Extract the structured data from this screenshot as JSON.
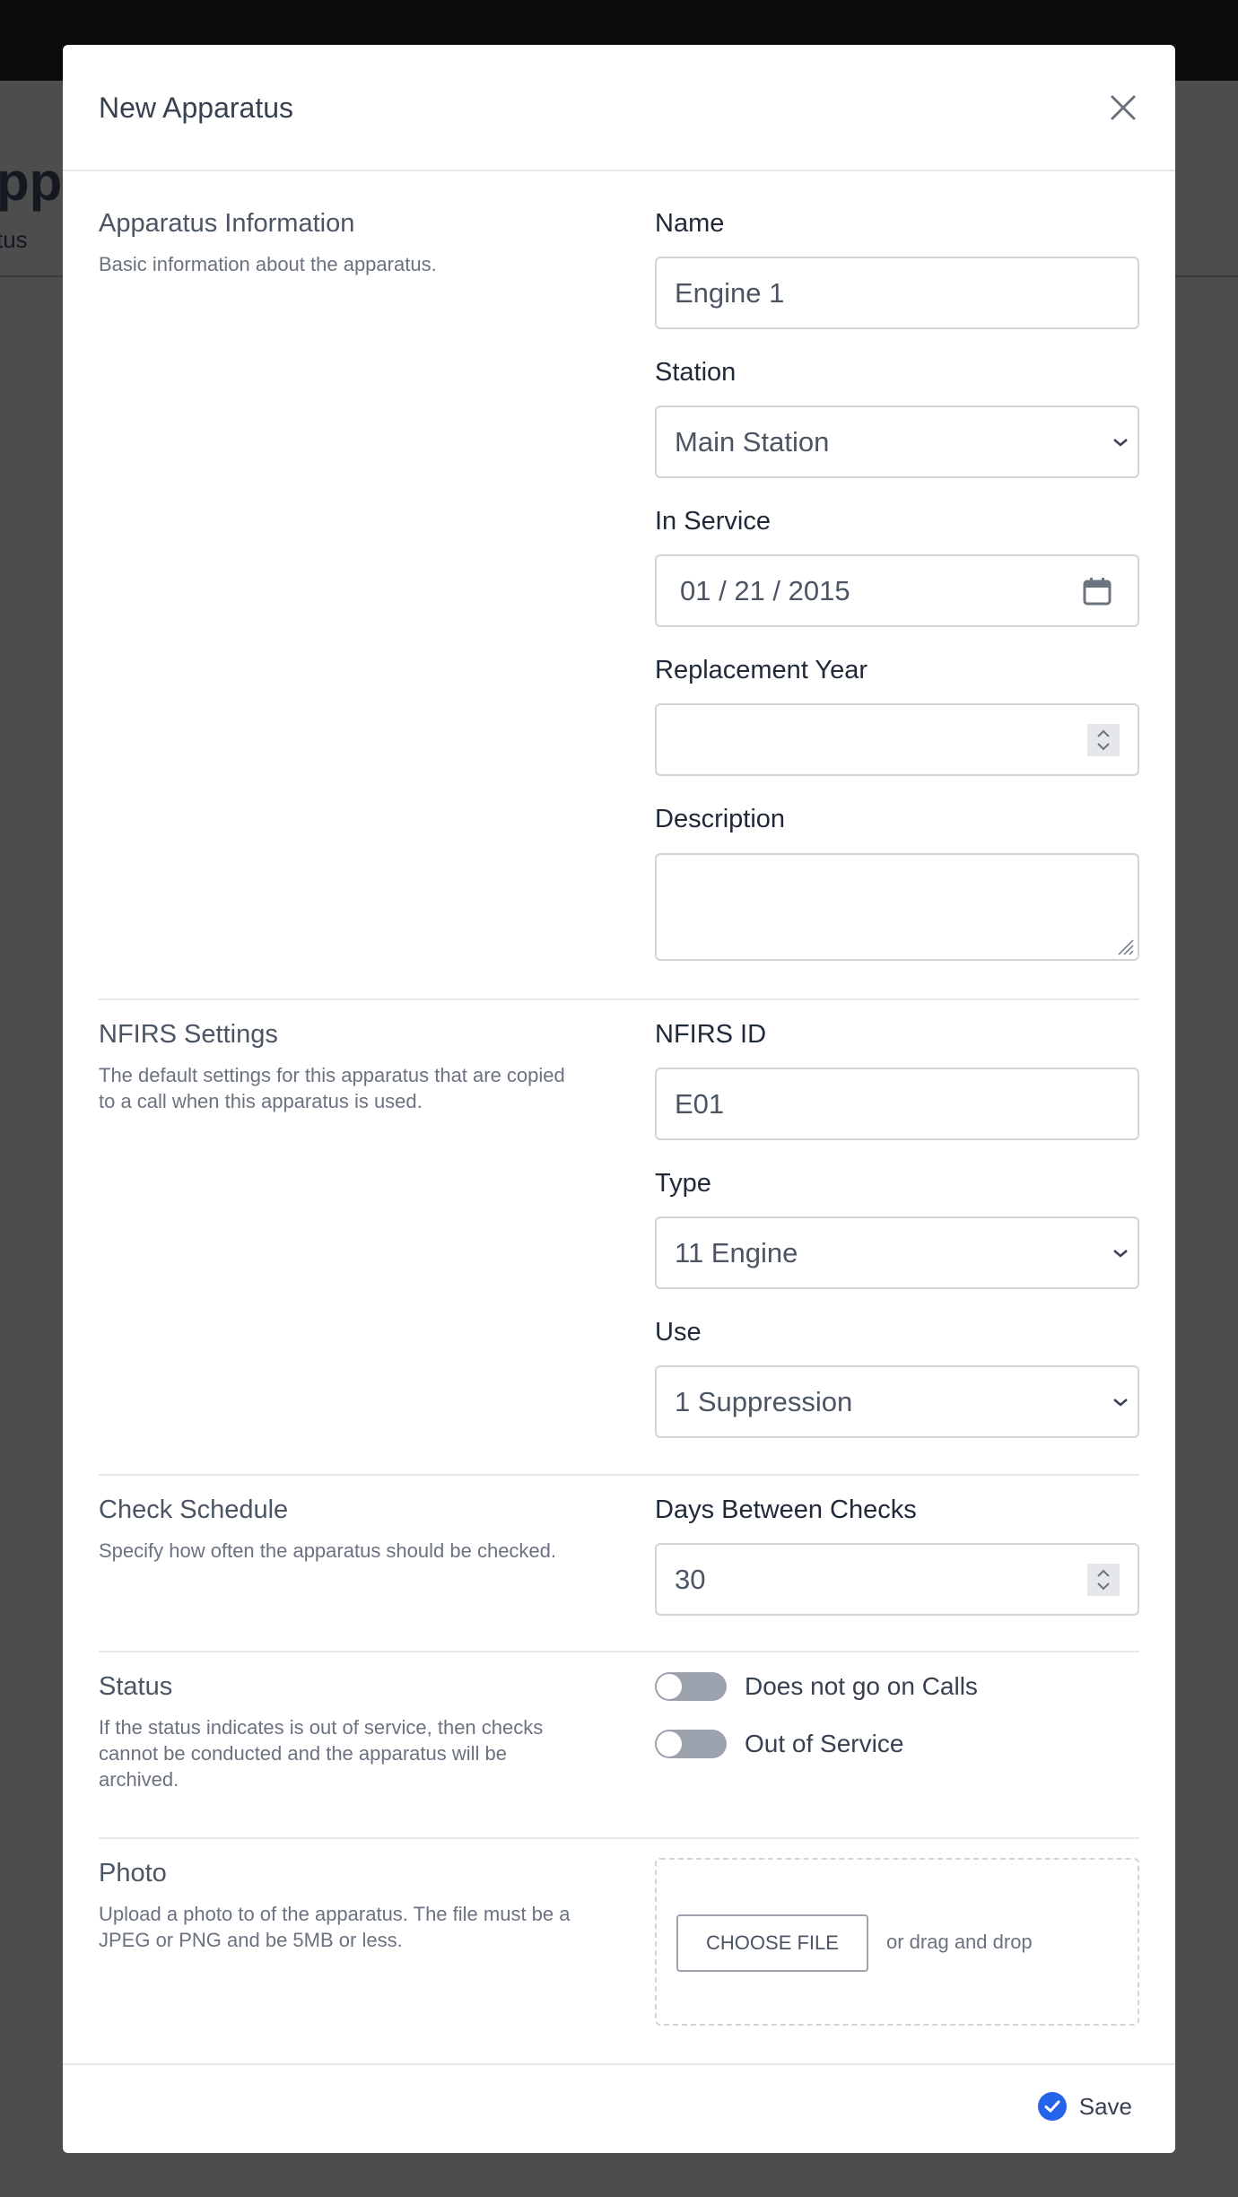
{
  "background": {
    "page_title_fragment": "ppa",
    "page_subtitle_fragment": "tus"
  },
  "modal": {
    "title": "New Apparatus",
    "close_icon": "close-icon"
  },
  "sections": {
    "info": {
      "title": "Apparatus Information",
      "description": "Basic information about the apparatus.",
      "name": {
        "label": "Name",
        "value": "Engine 1"
      },
      "station": {
        "label": "Station",
        "value": "Main Station"
      },
      "in_service": {
        "label": "In Service",
        "value": "01 / 21 / 2015"
      },
      "replacement_year": {
        "label": "Replacement Year",
        "value": ""
      },
      "description_field": {
        "label": "Description",
        "value": ""
      }
    },
    "nfirs": {
      "title": "NFIRS Settings",
      "description": "The default settings for this apparatus that are copied to a call when this apparatus is used.",
      "nfirs_id": {
        "label": "NFIRS ID",
        "value": "E01"
      },
      "type": {
        "label": "Type",
        "value": "11 Engine"
      },
      "use": {
        "label": "Use",
        "value": "1 Suppression"
      }
    },
    "schedule": {
      "title": "Check Schedule",
      "description": "Specify how often the apparatus should be checked.",
      "days": {
        "label": "Days Between Checks",
        "value": "30"
      }
    },
    "status": {
      "title": "Status",
      "description": "If the status indicates is out of service, then checks cannot be conducted and the apparatus will be archived.",
      "toggles": [
        {
          "label": "Does not go on Calls",
          "on": false
        },
        {
          "label": "Out of Service",
          "on": false
        }
      ]
    },
    "photo": {
      "title": "Photo",
      "description": "Upload a photo to of the apparatus. The file must be a JPEG or PNG and be 5MB or less.",
      "choose_label": "CHOOSE FILE",
      "drag_text": "or drag and drop"
    }
  },
  "footer": {
    "save_label": "Save",
    "accent_color": "#2563eb"
  }
}
